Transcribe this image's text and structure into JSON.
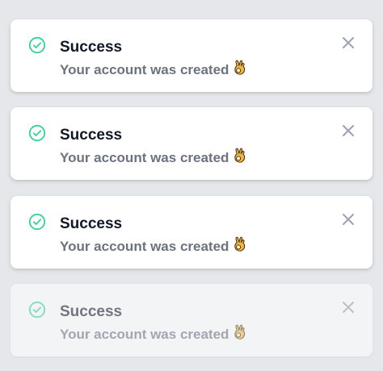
{
  "colors": {
    "success_accent": "#34d399",
    "title": "#111827",
    "message": "#6b7280",
    "close": "#9ca3af",
    "background": "#e5e7eb",
    "card": "#ffffff"
  },
  "toasts": [
    {
      "icon": "check-circle-icon",
      "title": "Success",
      "message": "Your account was created",
      "emoji": "ok-hand-emoji",
      "close_icon": "close-icon"
    },
    {
      "icon": "check-circle-icon",
      "title": "Success",
      "message": "Your account was created",
      "emoji": "ok-hand-emoji",
      "close_icon": "close-icon"
    },
    {
      "icon": "check-circle-icon",
      "title": "Success",
      "message": "Your account was created",
      "emoji": "ok-hand-emoji",
      "close_icon": "close-icon"
    },
    {
      "icon": "check-circle-icon",
      "title": "Success",
      "message": "Your account was created",
      "emoji": "ok-hand-emoji",
      "close_icon": "close-icon"
    }
  ]
}
